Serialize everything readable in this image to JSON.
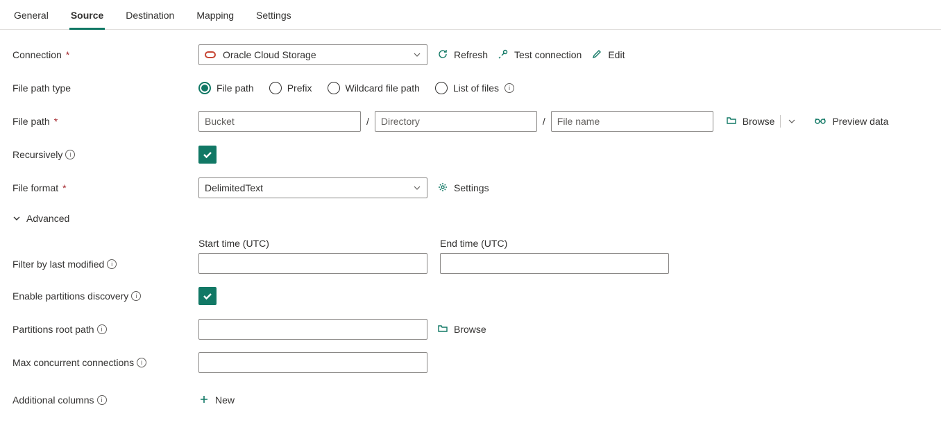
{
  "tabs": {
    "general": "General",
    "source": "Source",
    "destination": "Destination",
    "mapping": "Mapping",
    "settings": "Settings"
  },
  "labels": {
    "connection": "Connection",
    "file_path_type": "File path type",
    "file_path": "File path",
    "recursively": "Recursively",
    "file_format": "File format",
    "advanced": "Advanced",
    "filter_by_last_modified": "Filter by last modified",
    "enable_partitions_discovery": "Enable partitions discovery",
    "partitions_root_path": "Partitions root path",
    "max_concurrent_connections": "Max concurrent connections",
    "additional_columns": "Additional columns"
  },
  "connection": {
    "value": "Oracle Cloud Storage",
    "refresh": "Refresh",
    "test": "Test connection",
    "edit": "Edit"
  },
  "file_path_type": {
    "options": {
      "file_path": "File path",
      "prefix": "Prefix",
      "wildcard": "Wildcard file path",
      "list": "List of files"
    }
  },
  "file_path": {
    "bucket_placeholder": "Bucket",
    "directory_placeholder": "Directory",
    "filename_placeholder": "File name",
    "browse": "Browse",
    "preview": "Preview data"
  },
  "file_format": {
    "value": "DelimitedText",
    "settings": "Settings"
  },
  "time": {
    "start_label": "Start time (UTC)",
    "end_label": "End time (UTC)"
  },
  "partitions": {
    "browse": "Browse"
  },
  "additional": {
    "new": "New"
  }
}
